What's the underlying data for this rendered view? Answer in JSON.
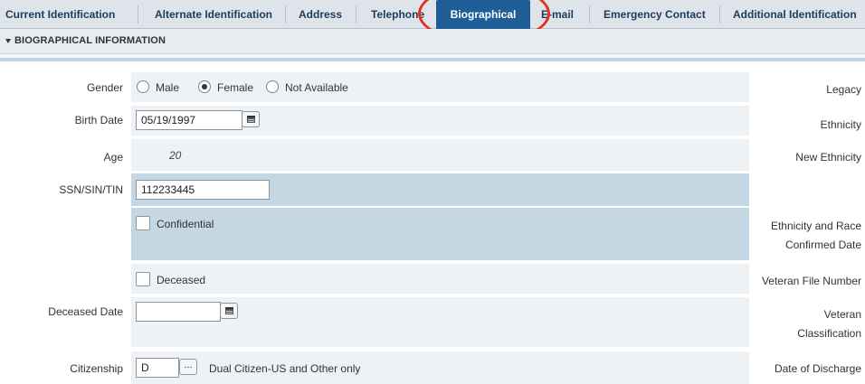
{
  "tabs": [
    {
      "label": "Current Identification"
    },
    {
      "label": "Alternate Identification"
    },
    {
      "label": "Address"
    },
    {
      "label": "Telephone"
    },
    {
      "label": "Biographical"
    },
    {
      "label": "E-mail"
    },
    {
      "label": "Emergency Contact"
    },
    {
      "label": "Additional Identification"
    }
  ],
  "active_tab": "Biographical",
  "section": {
    "title": "BIOGRAPHICAL INFORMATION"
  },
  "form": {
    "gender": {
      "label": "Gender",
      "options": [
        {
          "label": "Male",
          "selected": false
        },
        {
          "label": "Female",
          "selected": true
        },
        {
          "label": "Not Available",
          "selected": false
        }
      ]
    },
    "birth_date": {
      "label": "Birth Date",
      "value": "05/19/1997"
    },
    "age": {
      "label": "Age",
      "value": "20"
    },
    "ssn": {
      "label": "SSN/SIN/TIN",
      "value": "112233445"
    },
    "confidential": {
      "label": "Confidential",
      "checked": false
    },
    "deceased": {
      "label": "Deceased",
      "checked": false
    },
    "deceased_date": {
      "label": "Deceased Date",
      "value": ""
    },
    "citizenship": {
      "label": "Citizenship",
      "value": "D",
      "lookup_label": "...",
      "description": "Dual Citizen-US and Other only"
    }
  },
  "right_labels": {
    "legacy": "Legacy",
    "ethnicity": "Ethnicity",
    "new_ethnicity": "New Ethnicity",
    "eth_race_line1": "Ethnicity and Race",
    "eth_race_line2": "Confirmed Date",
    "veteran_file_number": "Veteran File Number",
    "veteran_line1": "Veteran",
    "veteran_line2": "Classification",
    "date_of_discharge": "Date of Discharge"
  },
  "colors": {
    "active_tab": "#1f5d96",
    "highlight_ring": "#e3301e",
    "row_panel": "#eef2f5",
    "row_panel_alt": "#c6d7e4"
  }
}
